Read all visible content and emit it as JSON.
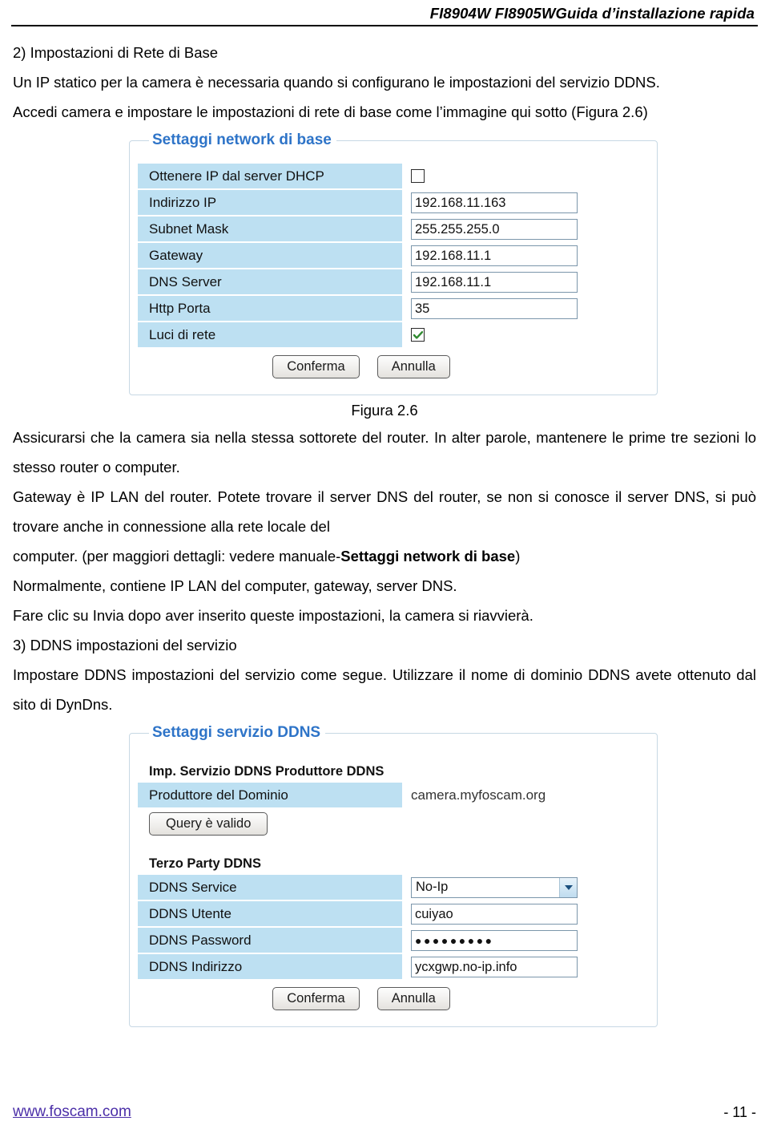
{
  "header": {
    "title": "FI8904W FI8905WGuida d’installazione rapida"
  },
  "body": {
    "section2_heading": "2) Impostazioni di Rete di Base",
    "para1": "Un IP statico per la camera è necessaria quando si configurano le impostazioni del servizio DDNS.",
    "para2": "Accedi camera e impostare le impostazioni di rete di base come l’immagine qui sotto (Figura 2.6)",
    "figure_caption": "Figura 2.6",
    "para3": "Assicurarsi che la camera sia nella stessa sottorete del router. In alter parole, mantenere le prime tre sezioni lo stesso router o computer.",
    "para4": "Gateway è IP LAN del router. Potete trovare il server DNS del router, se non si conosce il server DNS, si può trovare anche in connessione alla rete locale del",
    "para5_pre": "computer. (per maggiori dettagli: vedere manuale-",
    "para5_bold": "Settaggi network di base",
    "para5_post": ")",
    "para6": "Normalmente, contiene IP LAN del computer, gateway, server DNS.",
    "para7": "Fare clic su Invia dopo aver inserito queste impostazioni, la camera si riavvierà.",
    "section3_heading": "3) DDNS impostazioni del servizio",
    "para8": "Impostare DDNS impostazioni del servizio come segue. Utilizzare il nome di dominio DDNS avete ottenuto dal sito di DynDns."
  },
  "network_panel": {
    "legend": "Settaggi network di base",
    "rows": [
      {
        "label": "Ottenere IP dal server DHCP",
        "type": "checkbox",
        "checked": false
      },
      {
        "label": "Indirizzo IP",
        "type": "text",
        "value": "192.168.11.163"
      },
      {
        "label": "Subnet Mask",
        "type": "text",
        "value": "255.255.255.0"
      },
      {
        "label": "Gateway",
        "type": "text",
        "value": "192.168.11.1"
      },
      {
        "label": "DNS Server",
        "type": "text",
        "value": "192.168.11.1"
      },
      {
        "label": "Http Porta",
        "type": "text",
        "value": "35"
      },
      {
        "label": "Luci di rete",
        "type": "checkbox",
        "checked": true
      }
    ],
    "confirm_label": "Conferma",
    "cancel_label": "Annulla"
  },
  "ddns_panel": {
    "legend": "Settaggi servizio DDNS",
    "manufacturer_heading": "Imp. Servizio DDNS Produttore DDNS",
    "manufacturer_row": {
      "label": "Produttore del Dominio",
      "value": "camera.myfoscam.org"
    },
    "query_button_label": "Query è valido",
    "third_party_heading": "Terzo Party DDNS",
    "rows": [
      {
        "label": "DDNS Service",
        "type": "select",
        "value": "No-Ip"
      },
      {
        "label": "DDNS Utente",
        "type": "text",
        "value": "cuiyao"
      },
      {
        "label": "DDNS Password",
        "type": "password",
        "value": "●●●●●●●●●"
      },
      {
        "label": "DDNS Indirizzo",
        "type": "text",
        "value": "ycxgwp.no-ip.info"
      }
    ],
    "confirm_label": "Conferma",
    "cancel_label": "Annulla"
  },
  "footer": {
    "site": "www.foscam.com",
    "page_number": "- 11 -"
  },
  "colors": {
    "legend_blue": "#2e74c8",
    "row_label_blue": "#bde0f2",
    "link_purple": "#4b2fa8",
    "check_green": "#2f8a2f"
  }
}
